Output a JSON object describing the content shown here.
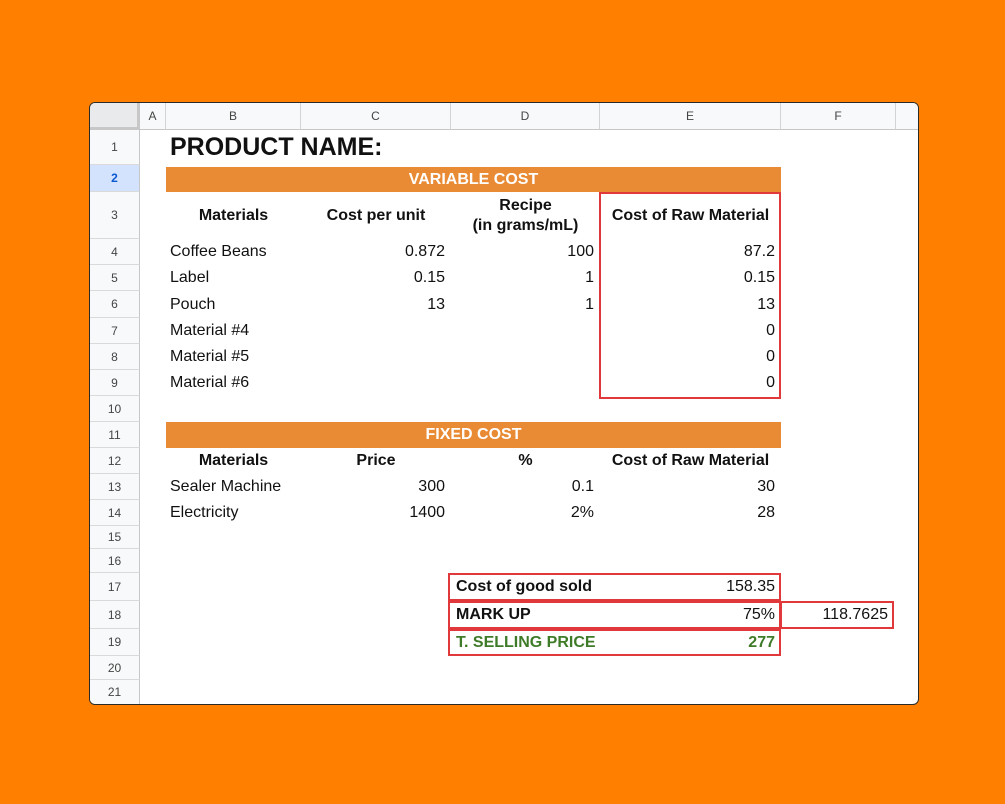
{
  "columns": [
    "A",
    "B",
    "C",
    "D",
    "E",
    "F"
  ],
  "rows": [
    "1",
    "2",
    "3",
    "4",
    "5",
    "6",
    "7",
    "8",
    "9",
    "10",
    "11",
    "12",
    "13",
    "14",
    "15",
    "16",
    "17",
    "18",
    "19",
    "20",
    "21"
  ],
  "title": "PRODUCT NAME:",
  "variable_cost": {
    "header": "VARIABLE COST",
    "col_materials": "Materials",
    "col_cost_per_unit": "Cost per unit",
    "col_recipe_line1": "Recipe",
    "col_recipe_line2": "(in grams/mL)",
    "col_cost_raw": "Cost of Raw Material",
    "items": [
      {
        "name": "Coffee Beans",
        "unit": "0.872",
        "recipe": "100",
        "cost": "87.2"
      },
      {
        "name": "Label",
        "unit": "0.15",
        "recipe": "1",
        "cost": "0.15"
      },
      {
        "name": "Pouch",
        "unit": "13",
        "recipe": "1",
        "cost": "13"
      },
      {
        "name": "Material #4",
        "unit": "",
        "recipe": "",
        "cost": "0"
      },
      {
        "name": "Material #5",
        "unit": "",
        "recipe": "",
        "cost": "0"
      },
      {
        "name": "Material #6",
        "unit": "",
        "recipe": "",
        "cost": "0"
      }
    ]
  },
  "fixed_cost": {
    "header": "FIXED COST",
    "col_materials": "Materials",
    "col_price": "Price",
    "col_percent": "%",
    "col_cost_raw": "Cost of Raw Material",
    "items": [
      {
        "name": "Sealer Machine",
        "price": "300",
        "pct": "0.1",
        "cost": "30"
      },
      {
        "name": "Electricity",
        "price": "1400",
        "pct": "2%",
        "cost": "28"
      }
    ]
  },
  "summary": {
    "cogs_label": "Cost of good sold",
    "cogs_value": "158.35",
    "markup_label": "MARK UP",
    "markup_value": "75%",
    "markup_amount": "118.7625",
    "selling_label": "T. SELLING PRICE",
    "selling_value": "277"
  },
  "colors": {
    "background": "#FF8000",
    "band": "#E98B35",
    "highlight": "#E0383B",
    "green": "#3e7b29",
    "selected_row": "#d3e3fd"
  }
}
